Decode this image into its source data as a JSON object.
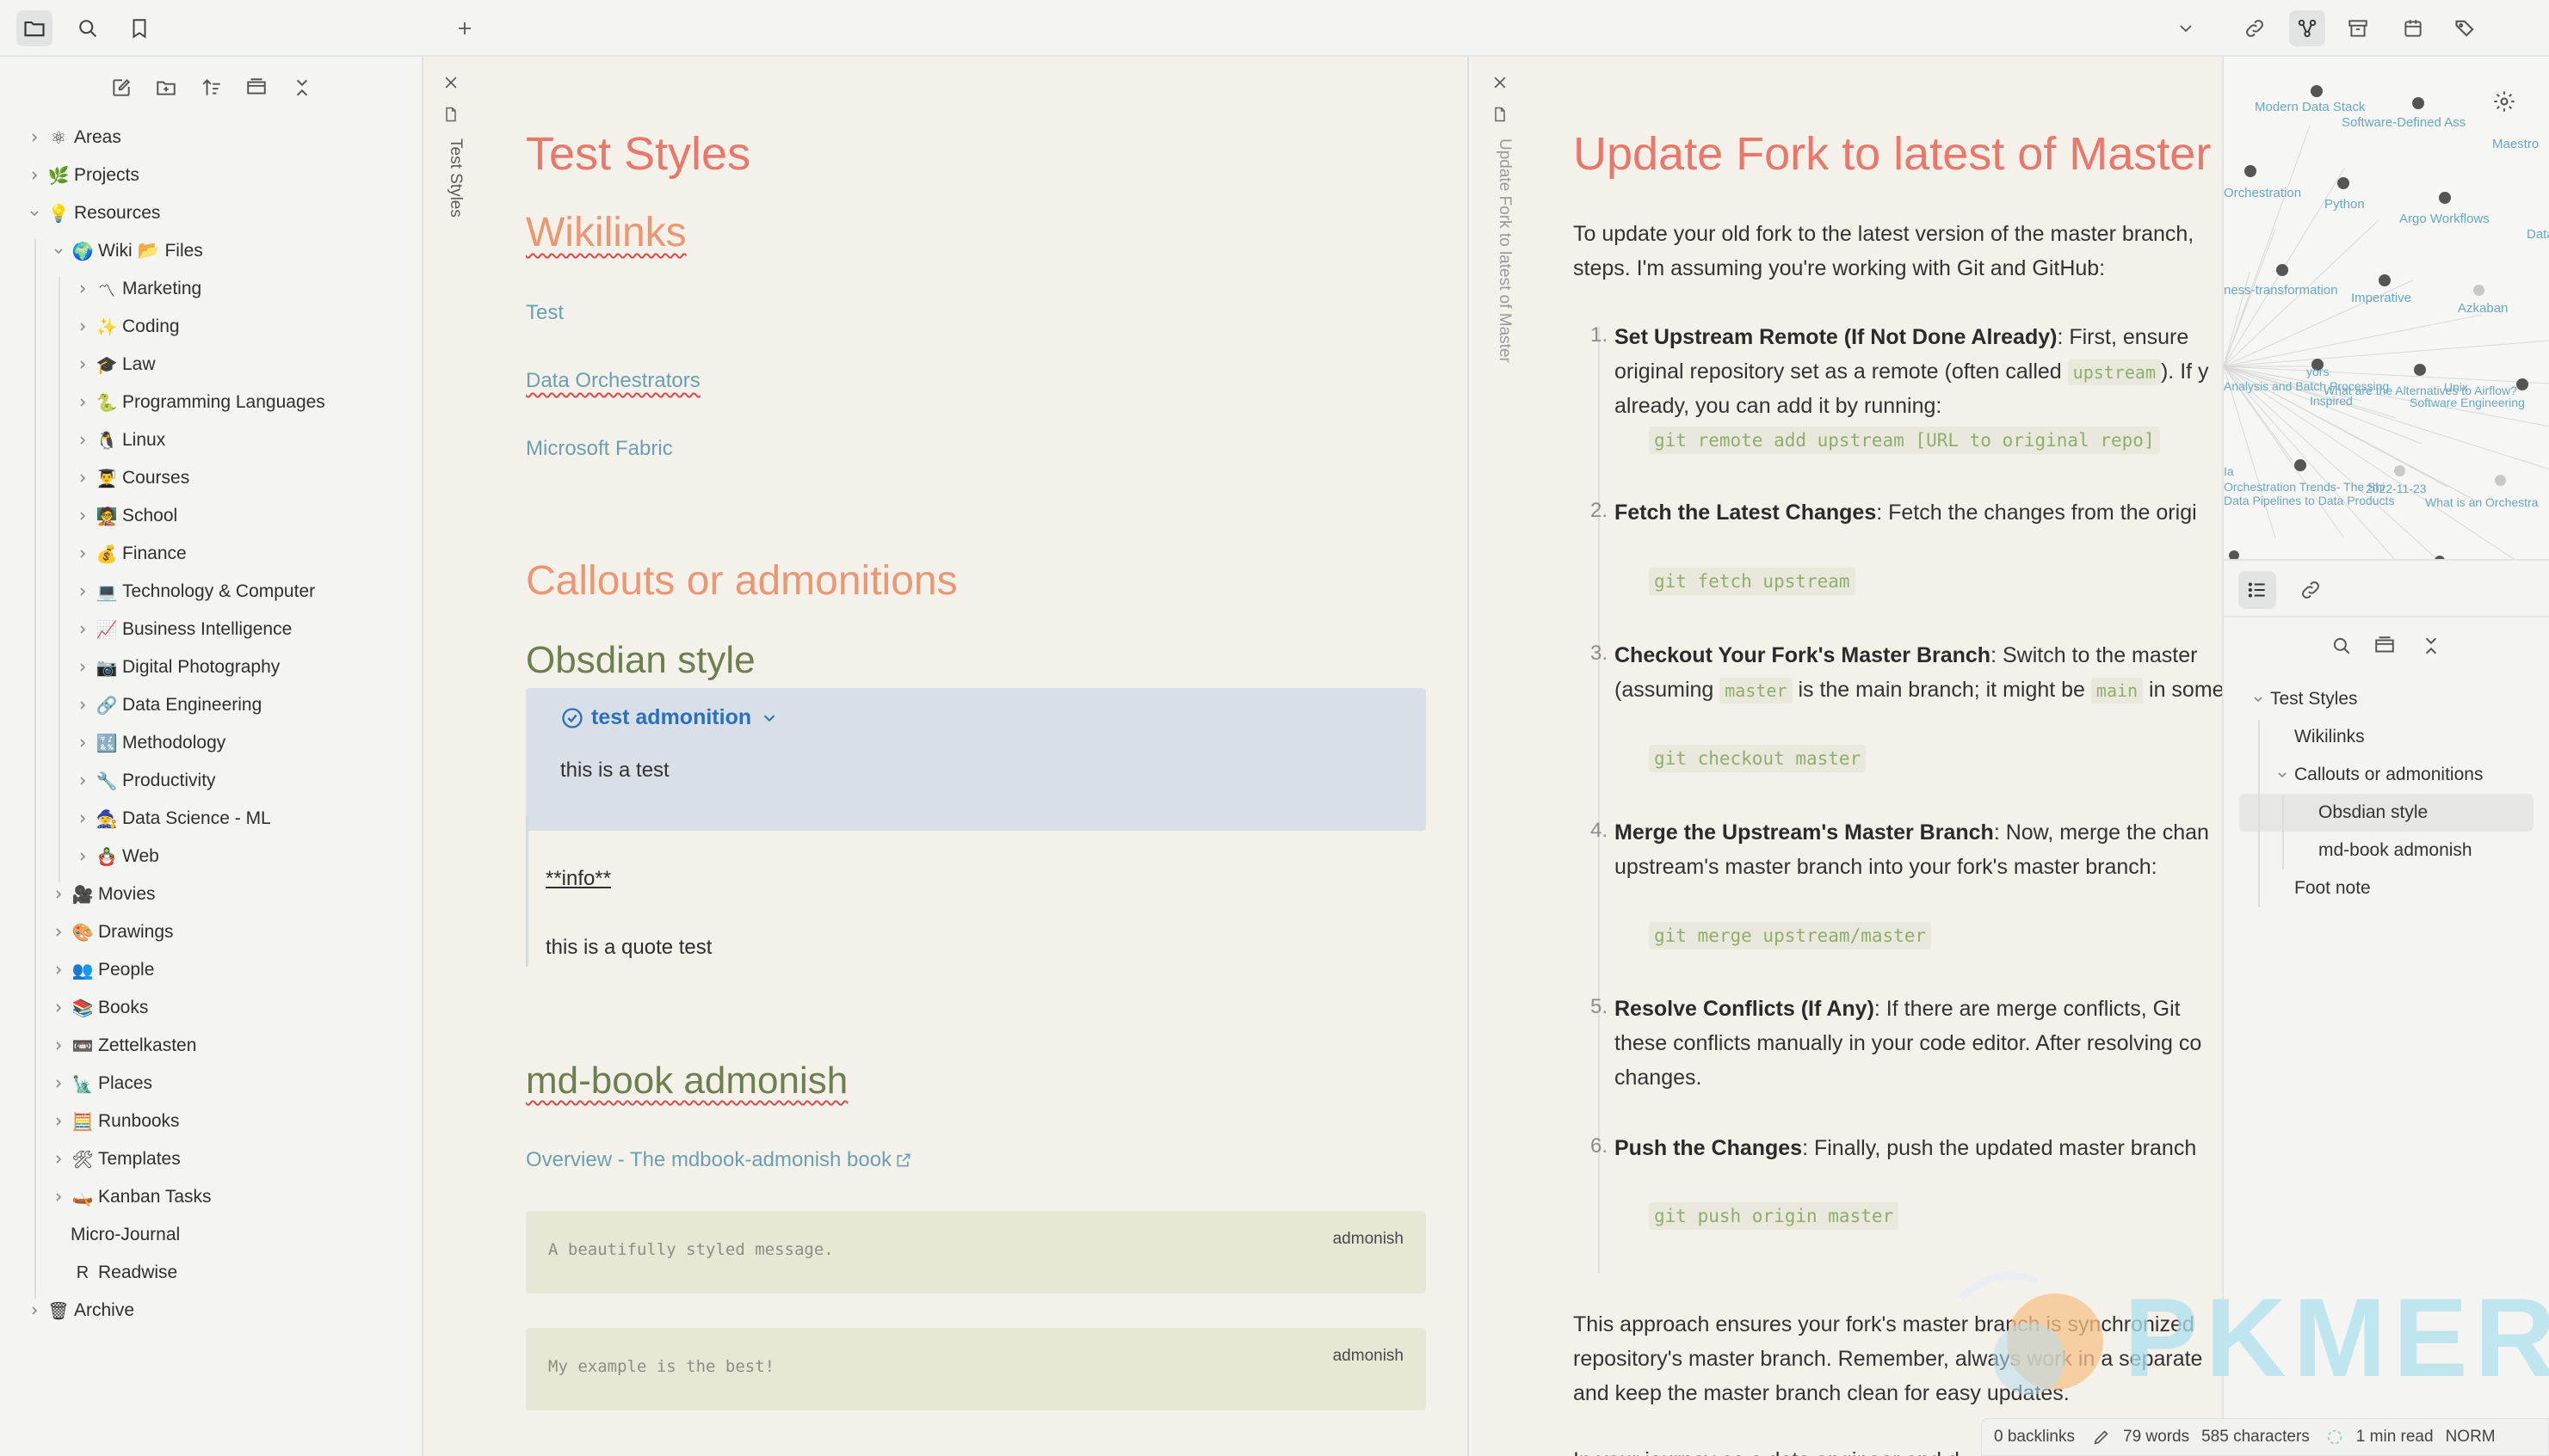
{
  "topbar": {
    "icons": [
      "folder-icon",
      "search-icon",
      "bookmark-icon",
      "plus-icon",
      "chevron-down-icon",
      "link-icon",
      "graph-icon",
      "archive-icon",
      "calendar-icon",
      "tags-icon"
    ]
  },
  "sidebar": {
    "toolbar_icons": [
      "new-note-icon",
      "new-folder-icon",
      "sort-icon",
      "collapse-view-icon",
      "collapse-all-icon"
    ],
    "tree": [
      {
        "emoji": "⚛",
        "label": "Areas"
      },
      {
        "emoji": "🌿",
        "label": "Projects"
      },
      {
        "emoji": "💡",
        "label": "Resources"
      },
      {
        "emoji": "🌍",
        "label": "Wiki 📂 Files"
      },
      {
        "emoji": "〽",
        "label": "Marketing"
      },
      {
        "emoji": "✨",
        "label": "Coding"
      },
      {
        "emoji": "🎓",
        "label": "Law"
      },
      {
        "emoji": "🐍",
        "label": "Programming Languages"
      },
      {
        "emoji": "🐧",
        "label": "Linux"
      },
      {
        "emoji": "👨‍🎓",
        "label": "Courses"
      },
      {
        "emoji": "🧑‍🏫",
        "label": "School"
      },
      {
        "emoji": "💰",
        "label": "Finance"
      },
      {
        "emoji": "💻",
        "label": "Technology & Computer"
      },
      {
        "emoji": "📈",
        "label": "Business Intelligence"
      },
      {
        "emoji": "📷",
        "label": "Digital Photography"
      },
      {
        "emoji": "🔗",
        "label": "Data Engineering"
      },
      {
        "emoji": "🔣",
        "label": "Methodology"
      },
      {
        "emoji": "🔧",
        "label": "Productivity"
      },
      {
        "emoji": "🧙",
        "label": "Data Science - ML"
      },
      {
        "emoji": "🪆",
        "label": "Web"
      },
      {
        "emoji": "🎥",
        "label": "Movies"
      },
      {
        "emoji": "🎨",
        "label": "Drawings"
      },
      {
        "emoji": "👥",
        "label": "People"
      },
      {
        "emoji": "📚",
        "label": "Books"
      },
      {
        "emoji": "📼",
        "label": "Zettelkasten"
      },
      {
        "emoji": "🗽",
        "label": "Places"
      },
      {
        "emoji": "🧮",
        "label": "Runbooks"
      },
      {
        "emoji": "🛠",
        "label": "Templates"
      },
      {
        "emoji": "🛶",
        "label": "Kanban Tasks"
      },
      {
        "emoji": "",
        "label": "Micro-Journal"
      },
      {
        "emoji": "R",
        "label": "Readwise"
      },
      {
        "emoji": "🗑",
        "label": "Archive"
      }
    ]
  },
  "pane1": {
    "tab_title": "Test Styles",
    "title": "Test Styles",
    "h_wikilinks": "Wikilinks",
    "links": [
      "Test",
      "Data Orchestrators",
      "Microsoft Fabric"
    ],
    "h_callouts": "Callouts or admonitions",
    "h_obsidian": "Obsdian style",
    "callout": {
      "title": "test admonition",
      "body": "this is a test"
    },
    "quote": {
      "title": "**info**",
      "body": "this is a quote test"
    },
    "h_mdbook": "md-book admonish",
    "mdbook_link": "Overview - The mdbook-admonish book",
    "admonish": [
      {
        "message": "A beautifully styled message.",
        "tag": "admonish"
      },
      {
        "message": "My example is the best!",
        "tag": "admonish"
      }
    ]
  },
  "pane2": {
    "tab_title": "Update Fork to latest of Master",
    "title": "Update Fork to latest of Master",
    "intro": [
      "To update your old fork to the latest version of the master branch,",
      "steps. I'm assuming you're working with Git and GitHub:"
    ],
    "steps": [
      {
        "num": "1.",
        "bold": "Set Upstream Remote (If Not Done Already)",
        "text": ": First, ensure",
        "l2a": "original repository set as a remote (often called ",
        "code": "upstream",
        "l2b": "). If y",
        "l3": "already, you can add it by running:",
        "block": "git remote add upstream [URL to original repo]"
      },
      {
        "num": "2.",
        "bold": "Fetch the Latest Changes",
        "text": ": Fetch the changes from the origi",
        "block": "git fetch upstream"
      },
      {
        "num": "3.",
        "bold": "Checkout Your Fork's Master Branch",
        "text": ": Switch to the master",
        "l2a": "(assuming ",
        "code": "master",
        "l2b": " is the main branch; it might be ",
        "code2": "main",
        "l2c": " in some",
        "block": "git checkout master"
      },
      {
        "num": "4.",
        "bold": "Merge the Upstream's Master Branch",
        "text": ": Now, merge the chan",
        "l2": "upstream's master branch into your fork's master branch:",
        "block": "git merge upstream/master"
      },
      {
        "num": "5.",
        "bold": "Resolve Conflicts (If Any)",
        "text": ": If there are merge conflicts, Git",
        "l2": "these conflicts manually in your code editor. After resolving co",
        "l3": "changes."
      },
      {
        "num": "6.",
        "bold": "Push the Changes",
        "text": ": Finally, push the updated master branch",
        "block": "git push origin master"
      }
    ],
    "outro": [
      "This approach ensures your fork's master branch is synchronized",
      "repository's master branch. Remember, always work in a separate",
      "and keep the master branch clean for easy updates."
    ],
    "cut": "In your journey as a data engineer and d"
  },
  "graph": {
    "labels": [
      "Modern Data Stack",
      "Software-Defined Ass",
      "Maestro",
      "Orchestration",
      "Python",
      "Argo Workflows",
      "Data In",
      "ness-transformation",
      "Imperative",
      "Azkaban",
      "Analysis and Batch Processing",
      "What are the Alternatives to Airflow?",
      "Software Engineering",
      "Inspired",
      "Orchestration Trends- The Shi",
      "2022-11-23",
      "Data Pipelines to Data Products",
      "What is an Orchestra",
      "yors",
      "Unix",
      "Ia"
    ]
  },
  "outline": {
    "items": [
      {
        "label": "Test Styles",
        "level": 0,
        "chev": true
      },
      {
        "label": "Wikilinks",
        "level": 1
      },
      {
        "label": "Callouts or admonitions",
        "level": 1,
        "chev": true
      },
      {
        "label": "Obsdian style",
        "level": 2,
        "selected": true
      },
      {
        "label": "md-book admonish",
        "level": 2
      },
      {
        "label": "Foot note",
        "level": 1
      }
    ]
  },
  "status": {
    "backlinks": "0 backlinks",
    "words": "79 words",
    "chars": "585 characters",
    "read": "1 min read",
    "mode": "NORM"
  },
  "watermark": "PKMER",
  "colors": {
    "accent_heading": "#e9786a",
    "link": "#6ba0b4",
    "callout_bg": "#d8dfe6",
    "callout_title": "#2a6fc0"
  }
}
